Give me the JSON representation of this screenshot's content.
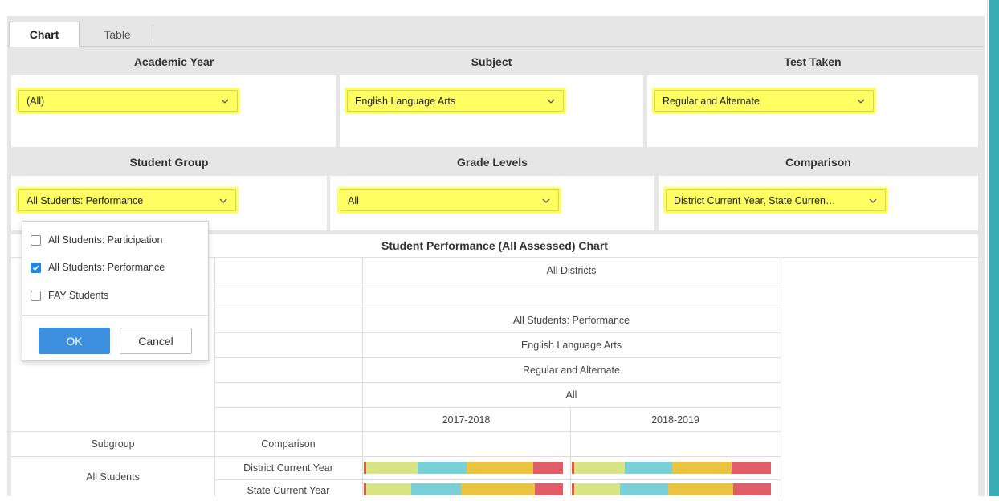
{
  "tabs": [
    {
      "label": "Chart",
      "active": true
    },
    {
      "label": "Table",
      "active": false
    }
  ],
  "filters": {
    "academic_year": {
      "label": "Academic Year",
      "value": "(All)"
    },
    "subject": {
      "label": "Subject",
      "value": "English Language Arts"
    },
    "test_taken": {
      "label": "Test Taken",
      "value": "Regular and Alternate"
    },
    "student_group": {
      "label": "Student Group",
      "value": "All Students: Performance"
    },
    "grade_levels": {
      "label": "Grade Levels",
      "value": "All"
    },
    "comparison": {
      "label": "Comparison",
      "value": "District Current Year, State Curren…"
    }
  },
  "student_group_popup": {
    "options": [
      {
        "label": "All Students: Participation",
        "checked": false
      },
      {
        "label": "All Students: Performance",
        "checked": true
      },
      {
        "label": "FAY Students",
        "checked": false
      }
    ],
    "ok_label": "OK",
    "cancel_label": "Cancel"
  },
  "chart": {
    "title": "Student Performance (All Assessed) Chart",
    "header_rows": [
      "All Districts",
      "",
      "All Students: Performance",
      "English Language Arts",
      "Regular and Alternate",
      "All"
    ],
    "years": [
      "2017-2018",
      "2018-2019"
    ],
    "subgroup_header": "Subgroup",
    "comparison_header": "Comparison",
    "subgroup": "All Students",
    "comparisons": [
      "District Current Year",
      "State Current Year"
    ]
  },
  "chart_data": {
    "type": "bar",
    "stacked": true,
    "orientation": "horizontal",
    "title": "Student Performance (All Assessed) Chart",
    "categories": [
      "District Current Year",
      "State Current Year"
    ],
    "groups": [
      "2017-2018",
      "2018-2019"
    ],
    "segment_colors": [
      "#e8553d",
      "#d8e584",
      "#79d1d7",
      "#eac440",
      "#e05c66"
    ],
    "panels": [
      {
        "group": "2017-2018",
        "series_values": [
          [
            1,
            24,
            23,
            31,
            14
          ],
          [
            1,
            21,
            23,
            34,
            13
          ]
        ]
      },
      {
        "group": "2018-2019",
        "series_values": [
          [
            1,
            25,
            23,
            29,
            19
          ],
          [
            1,
            22,
            23,
            31,
            18
          ]
        ]
      }
    ]
  },
  "colors": {
    "highlight": "#ffff62",
    "accent": "#3aadb4",
    "ok_button": "#3d8fe0"
  }
}
